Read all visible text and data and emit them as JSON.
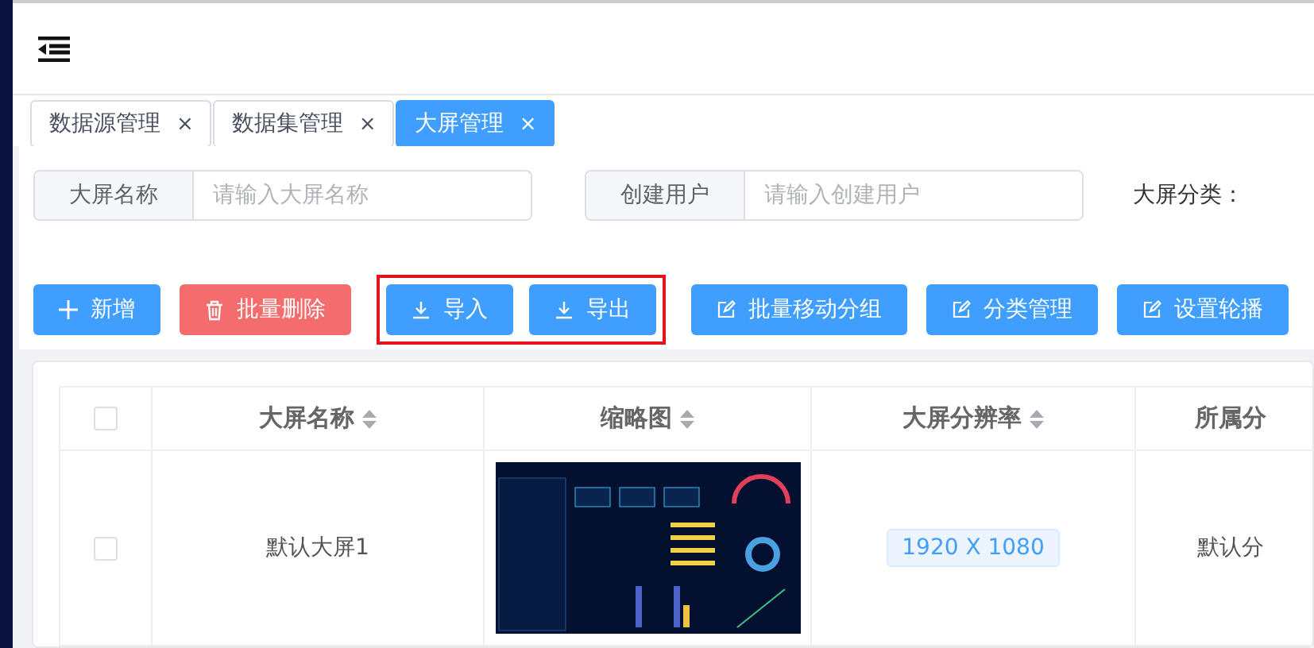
{
  "tabs": [
    {
      "label": "数据源管理",
      "close": "×",
      "selected": false
    },
    {
      "label": "数据集管理",
      "close": "×",
      "selected": false
    },
    {
      "label": "大屏管理",
      "close": "×",
      "selected": true
    }
  ],
  "filters": [
    {
      "kind": "input",
      "label": "大屏名称",
      "placeholder": "请输入大屏名称"
    },
    {
      "kind": "input",
      "label": "创建用户",
      "placeholder": "请输入创建用户"
    },
    {
      "kind": "label",
      "label": "大屏分类："
    }
  ],
  "toolbar": [
    {
      "label": "新增",
      "kind": "add",
      "highlighted": false
    },
    {
      "label": "批量删除",
      "kind": "delete",
      "highlighted": false
    },
    {
      "label": "导入",
      "kind": "transfer",
      "highlighted": true
    },
    {
      "label": "导出",
      "kind": "transfer",
      "highlighted": true
    },
    {
      "label": "批量移动分组",
      "kind": "edit",
      "highlighted": false
    },
    {
      "label": "分类管理",
      "kind": "edit",
      "highlighted": false
    },
    {
      "label": "设置轮播",
      "kind": "edit",
      "highlighted": false
    }
  ],
  "table": {
    "all_checked": false,
    "columns": [
      {
        "label": "大屏名称",
        "sortable": true
      },
      {
        "label": "缩略图",
        "sortable": true
      },
      {
        "label": "大屏分辨率",
        "sortable": true
      },
      {
        "label": "所属分",
        "sortable": false
      }
    ],
    "rows": [
      {
        "checked": false,
        "name": "默认大屏1",
        "resolution": "1920 X 1080",
        "group": "默认分"
      }
    ]
  }
}
